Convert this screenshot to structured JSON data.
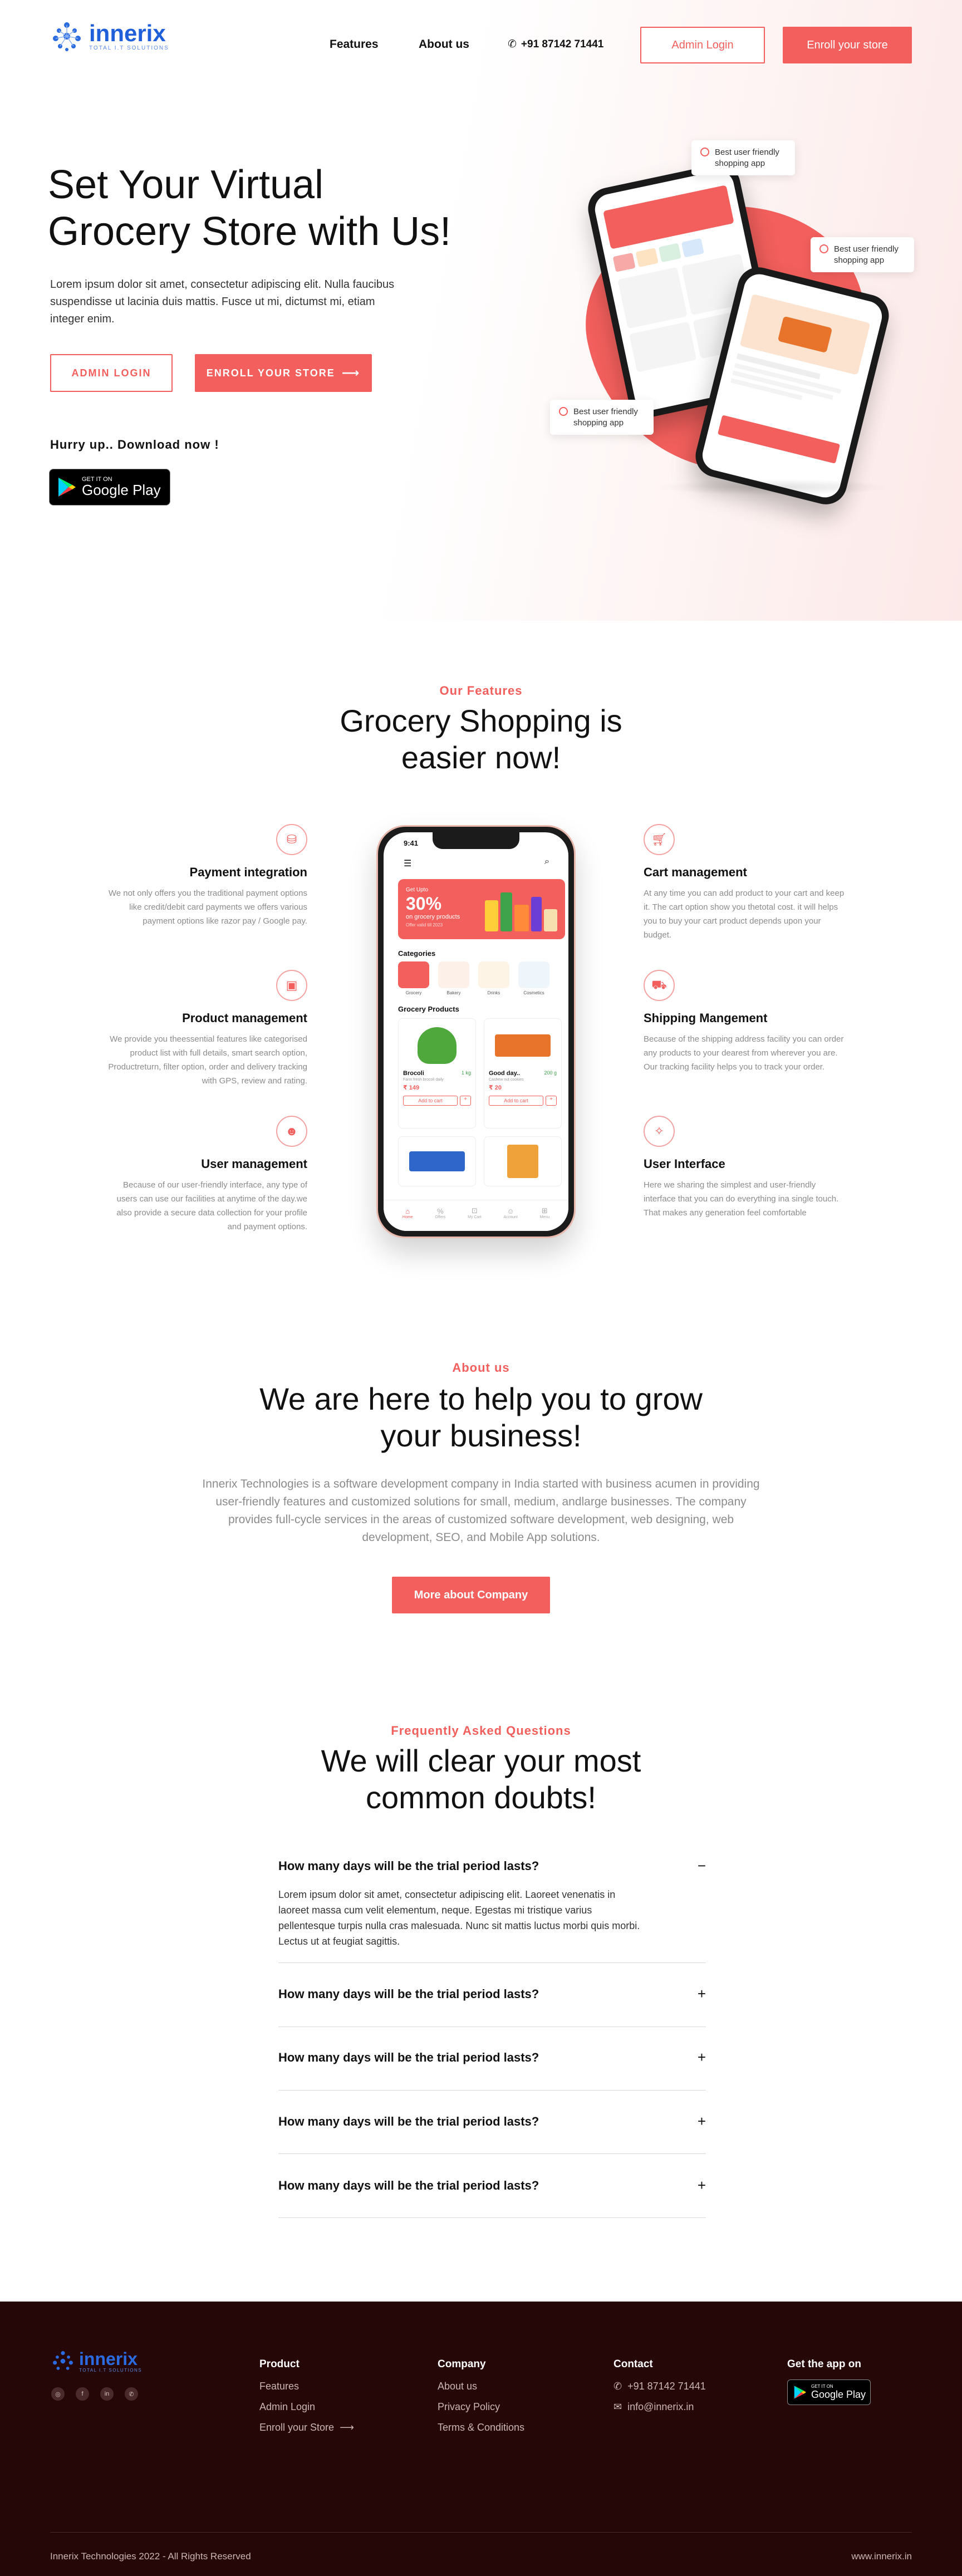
{
  "brand": {
    "name": "innerix",
    "tagline": "TOTAL I.T SOLUTIONS"
  },
  "nav": {
    "features": "Features",
    "about": "About us",
    "phone": "+91 87142 71441",
    "admin_login": "Admin Login",
    "enroll": "Enroll your store"
  },
  "hero": {
    "title_line1": "Set Your Virtual",
    "title_line2": "Grocery Store with Us!",
    "description": "Lorem ipsum dolor sit amet, consectetur adipiscing elit. Nulla faucibus suspendisse ut lacinia duis mattis. Fusce ut mi, dictumst mi, etiam integer enim.",
    "admin_btn": "ADMIN LOGIN",
    "enroll_btn": "ENROLL YOUR STORE",
    "download_label": "Hurry up.. Download now !",
    "gp_small": "GET IT ON",
    "gp_big": "Google Play",
    "tooltip1": "Best user friendly shopping app",
    "tooltip2": "Best user friendly shopping app",
    "tooltip3": "Best user friendly shopping app"
  },
  "features": {
    "eyebrow": "Our Features",
    "title_line1": "Grocery Shopping is",
    "title_line2": "easier now!",
    "left": [
      {
        "title": "Payment integration",
        "text": "We not only offers you the traditional payment options like credit/debit card payments we offers various payment options like razor pay / Google pay."
      },
      {
        "title": "Product management",
        "text": "We provide you theessential features like categorised product list with full details, smart search option, Productreturn, filter option, order and delivery tracking with GPS, review and rating."
      },
      {
        "title": "User management",
        "text": "Because of our user-friendly interface, any type of users can use our facilities at anytime of the day.we also provide a secure data collection for your profile and payment options."
      }
    ],
    "right": [
      {
        "title": "Cart management",
        "text": "At any time you can add product to your cart and keep it. The cart option show you thetotal cost. it will helps you to buy your cart product depends upon your budget."
      },
      {
        "title": "Shipping Mangement",
        "text": "Because of the shipping address facility you can order any products to your dearest from wherever you are. Our tracking facility helps you to track your order."
      },
      {
        "title": "User Interface",
        "text": "Here we sharing the simplest and user-friendly interface that you can do everything ina single touch. That makes any generation feel comfortable"
      }
    ]
  },
  "phone": {
    "time": "9:41",
    "banner_small": "Get Upto",
    "banner_big": "30%",
    "banner_line": "on grocery products",
    "banner_sub": "Offer valid till 2023",
    "categories_title": "Categories",
    "categories": [
      "Grocery",
      "Bakery",
      "Drinks",
      "Cosmetics"
    ],
    "products_title": "Grocery Products",
    "products": [
      {
        "name": "Brocoli",
        "qty": "1 kg",
        "desc": "Farm fresh brocoli daily",
        "price": "₹ 149",
        "cart": "Add to cart"
      },
      {
        "name": "Good day..",
        "qty": "200 g",
        "desc": "Cashew nut cookies",
        "price": "₹ 20",
        "cart": "Add to cart"
      }
    ],
    "tabs": [
      "Home",
      "Offers",
      "My Cart",
      "Account",
      "Menu"
    ]
  },
  "about": {
    "eyebrow": "About us",
    "title_line1": "We are here to help you to grow",
    "title_line2": "your business!",
    "text": "Innerix Technologies is a software development company in India started with business acumen in providing user-friendly features and customized solutions for small, medium, andlarge businesses. The company provides full-cycle services in the areas of customized software development, web designing, web development, SEO, and Mobile App solutions.",
    "button": "More about Company"
  },
  "faq": {
    "eyebrow": "Frequently Asked Questions",
    "title_line1": "We will clear your most",
    "title_line2": "common doubts!",
    "items": [
      {
        "q": "How many days will be the trial period lasts?",
        "a": "Lorem ipsum dolor sit amet, consectetur adipiscing elit. Laoreet venenatis in laoreet massa cum velit elementum, neque. Egestas mi tristique varius pellentesque turpis nulla cras malesuada. Nunc sit mattis luctus morbi quis morbi. Lectus ut at feugiat sagittis.",
        "icon": "−"
      },
      {
        "q": "How many days will be the trial period lasts?",
        "icon": "+"
      },
      {
        "q": "How many days will be the trial period lasts?",
        "icon": "+"
      },
      {
        "q": "How many days will be the trial period lasts?",
        "icon": "+"
      },
      {
        "q": "How many days will be the trial period lasts?",
        "icon": "+"
      }
    ]
  },
  "footer": {
    "product_title": "Product",
    "product_links": [
      "Features",
      "Admin Login",
      "Enroll your Store"
    ],
    "company_title": "Company",
    "company_links": [
      "About us",
      "Privacy Policy",
      "Terms & Conditions"
    ],
    "contact_title": "Contact",
    "phone": "+91 87142 71441",
    "email": "info@innerix.in",
    "app_title": "Get the app on",
    "gp_small": "GET IT ON",
    "gp_big": "Google Play",
    "copyright": "Innerix Technologies 2022 - All Rights Reserved",
    "website": "www.innerix.in"
  },
  "colors": {
    "accent": "#f25f5c",
    "footer_bg": "#260707",
    "brand_blue": "#1f5fd9"
  }
}
